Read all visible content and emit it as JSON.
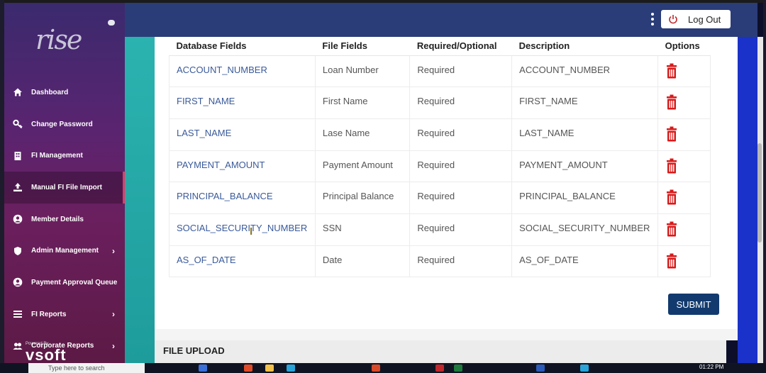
{
  "sidebar": {
    "logo_text": "rise",
    "items": [
      {
        "label": "Dashboard",
        "icon": "home-icon",
        "has_chevron": false,
        "active": false
      },
      {
        "label": "Change Password",
        "icon": "key-icon",
        "has_chevron": false,
        "active": false
      },
      {
        "label": "FI Management",
        "icon": "building-icon",
        "has_chevron": false,
        "active": false
      },
      {
        "label": "Manual FI File Import",
        "icon": "upload-icon",
        "has_chevron": false,
        "active": true
      },
      {
        "label": "Member Details",
        "icon": "user-icon",
        "has_chevron": false,
        "active": false
      },
      {
        "label": "Admin Management",
        "icon": "shield-icon",
        "has_chevron": true,
        "active": false
      },
      {
        "label": "Payment Approval Queue",
        "icon": "user-circle-icon",
        "has_chevron": false,
        "active": false
      },
      {
        "label": "FI Reports",
        "icon": "list-icon",
        "has_chevron": true,
        "active": false
      },
      {
        "label": "Corporate Reports",
        "icon": "users-icon",
        "has_chevron": true,
        "active": false
      }
    ],
    "powered_by": "Powered By",
    "powered_logo": "vsoft"
  },
  "header": {
    "logout_label": "Log Out"
  },
  "table": {
    "headers": [
      "Database Fields",
      "File Fields",
      "Required/Optional",
      "Description",
      "Options"
    ],
    "rows": [
      [
        "ACCOUNT_NUMBER",
        "Loan Number",
        "Required",
        "ACCOUNT_NUMBER"
      ],
      [
        "FIRST_NAME",
        "First Name",
        "Required",
        "FIRST_NAME"
      ],
      [
        "LAST_NAME",
        "Lase Name",
        "Required",
        "LAST_NAME"
      ],
      [
        "PAYMENT_AMOUNT",
        "Payment Amount",
        "Required",
        "PAYMENT_AMOUNT"
      ],
      [
        "PRINCIPAL_BALANCE",
        "Principal Balance",
        "Required",
        "PRINCIPAL_BALANCE"
      ],
      [
        "SOCIAL_SECURITY_NUMBER",
        "SSN",
        "Required",
        "SOCIAL_SECURITY_NUMBER"
      ],
      [
        "AS_OF_DATE",
        "Date",
        "Required",
        "AS_OF_DATE"
      ]
    ],
    "delete_icon": "trash-icon",
    "delete_color": "#d81b1b"
  },
  "submit_label": "SUBMIT",
  "file_upload_title": "FILE UPLOAD",
  "taskbar": {
    "search_placeholder": "Type here to search",
    "clock": "01:22 PM"
  },
  "colors": {
    "header": "#2a3d78",
    "submit": "#123a6e",
    "link": "#3a5a9a"
  }
}
